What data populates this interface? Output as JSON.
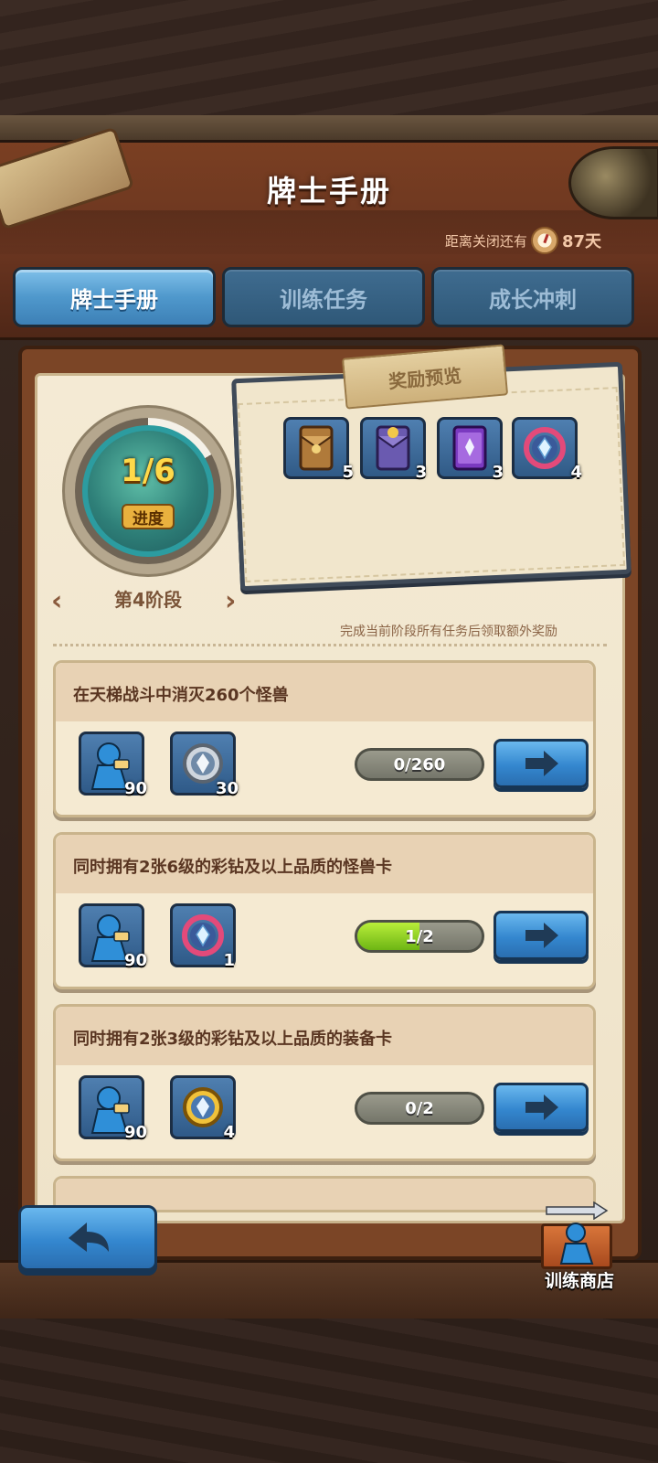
{
  "header": {
    "title": "牌士手册",
    "countdown_label": "距离关闭还有",
    "countdown_value": "87天"
  },
  "tabs": [
    {
      "label": "牌士手册",
      "active": true
    },
    {
      "label": "训练任务",
      "active": false
    },
    {
      "label": "成长冲刺",
      "active": false
    }
  ],
  "progress": {
    "fraction": "1/6",
    "label": "进度",
    "completed": 1,
    "total": 6,
    "stage": "第4阶段"
  },
  "reward_preview": {
    "title": "奖励预览",
    "items": [
      {
        "icon": "brown-card-pack-icon",
        "count": "5"
      },
      {
        "icon": "purple-card-pack-icon",
        "count": "3"
      },
      {
        "icon": "violet-card-box-icon",
        "count": "3"
      },
      {
        "icon": "rainbow-diamond-icon",
        "count": "4"
      }
    ],
    "hint": "完成当前阶段所有任务后领取额外奖励"
  },
  "tasks": [
    {
      "title": "在天梯战斗中消灭260个怪兽",
      "rewards": [
        {
          "icon": "trainer-token-icon",
          "count": "90"
        },
        {
          "icon": "silver-diamond-icon",
          "count": "30"
        }
      ],
      "progress_text": "0/260",
      "progress_value": 0
    },
    {
      "title": "同时拥有2张6级的彩钻及以上品质的怪兽卡",
      "rewards": [
        {
          "icon": "trainer-token-icon",
          "count": "90"
        },
        {
          "icon": "rainbow-diamond-icon",
          "count": "1"
        }
      ],
      "progress_text": "1/2",
      "progress_value": 0.5
    },
    {
      "title": "同时拥有2张3级的彩钻及以上品质的装备卡",
      "rewards": [
        {
          "icon": "trainer-token-icon",
          "count": "90"
        },
        {
          "icon": "gold-diamond-icon",
          "count": "4"
        }
      ],
      "progress_text": "0/2",
      "progress_value": 0
    }
  ],
  "footer": {
    "shop_label": "训练商店"
  },
  "colors": {
    "accent_blue": "#3487cf",
    "progress_green": "#6db514",
    "title_gold": "#ffd94a"
  }
}
